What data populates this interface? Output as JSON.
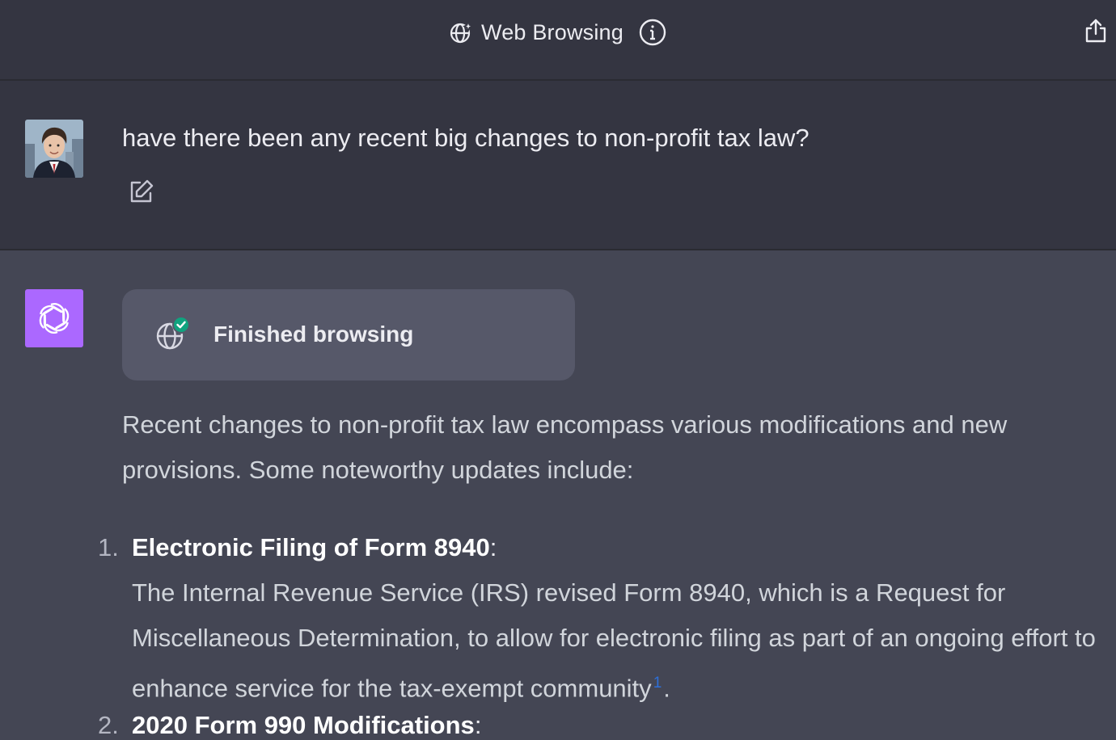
{
  "header": {
    "mode_title": "Web Browsing",
    "mode_icon": "globe-sparkle-icon",
    "info_icon": "info-icon",
    "share_icon": "share-icon"
  },
  "user_message": {
    "text": "have there been any recent big changes to non-profit tax law?",
    "edit_icon": "edit-icon"
  },
  "assistant": {
    "browse_status": "Finished browsing",
    "intro": "Recent changes to non-profit tax law encompass various modifications and new provisions. Some noteworthy updates include:",
    "items": [
      {
        "number": "1.",
        "title": "Electronic Filing of Form 8940",
        "suffix": ":",
        "body": "The Internal Revenue Service (IRS) revised Form 8940, which is a Request for Miscellaneous Determination, to allow for electronic filing as part of an ongoing effort to enhance service for the tax-exempt community",
        "citation": "1",
        "end": "."
      },
      {
        "number": "2.",
        "title": "2020 Form 990 Modifications",
        "suffix": ":"
      }
    ]
  },
  "colors": {
    "page_bg": "#444654",
    "user_row_bg": "#343541",
    "browse_card_bg": "#565869",
    "bot_avatar_bg": "#ab68ff",
    "citation": "#2e6fd8",
    "check_badge": "#10a37f"
  }
}
